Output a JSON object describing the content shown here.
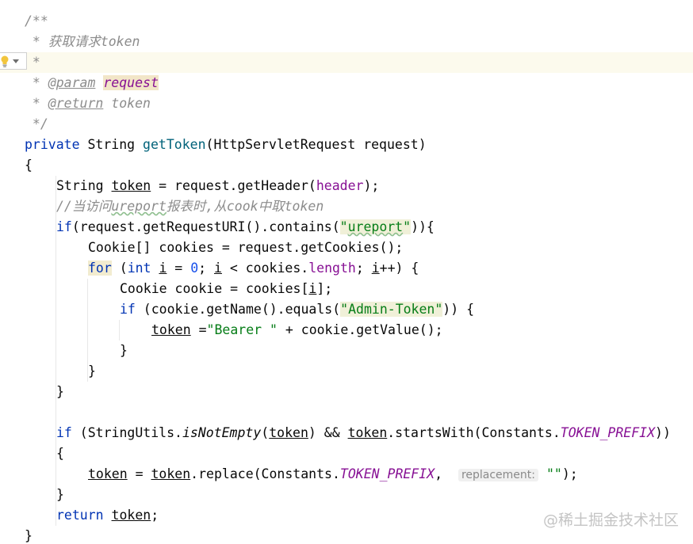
{
  "watermark": "@稀土掘金技术社区",
  "code": {
    "l1_open": "/**",
    "l2_text": " * 获取请求token",
    "l3_star": " *",
    "l4_star": " * ",
    "l4_tag": "@param",
    "l4_name": "request",
    "l5_star": " * ",
    "l5_tag": "@return",
    "l5_text": " token",
    "l6_close": " */",
    "l7_kw": "private",
    "l7_type": " String ",
    "l7_fn": "getToken",
    "l7_sig": "(HttpServletRequest request)",
    "l8_brace": "{",
    "l9_type": "String ",
    "l9_var": "token",
    "l9_mid": " = request.getHeader(",
    "l9_field": "header",
    "l9_end": ");",
    "l10_comment_a": "//当访问",
    "l10_comment_b": "ureport",
    "l10_comment_c": "报表时,从cook中取token",
    "l11_kw": "if",
    "l11_a": "(request.getRequestURI().contains(",
    "l11_str_q1": "\"",
    "l11_str_word": "ureport",
    "l11_str_q2": "\"",
    "l11_end": ")){",
    "l12_text": "Cookie[] cookies = request.getCookies();",
    "l13_kw": "for",
    "l13_a": " (",
    "l13_int": "int",
    "l13_sp": " ",
    "l13_i1": "i",
    "l13_b": " = ",
    "l13_zero": "0",
    "l13_c": "; ",
    "l13_i2": "i",
    "l13_d": " < cookies.",
    "l13_len": "length",
    "l13_e": "; ",
    "l13_i3": "i",
    "l13_f": "++) {",
    "l14_a": "Cookie cookie = cookies[",
    "l14_i": "i",
    "l14_b": "];",
    "l15_kw": "if",
    "l15_a": " (cookie.getName().equals(",
    "l15_str": "\"Admin-Token\"",
    "l15_b": ")) {",
    "l16_var": "token",
    "l16_a": " =",
    "l16_str": "\"Bearer \"",
    "l16_b": " + cookie.getValue();",
    "l17_brace": "}",
    "l18_brace": "}",
    "l19_brace": "}",
    "l21_kw": "if",
    "l21_a": " (StringUtils.",
    "l21_fn": "isNotEmpty",
    "l21_b": "(",
    "l21_var1": "token",
    "l21_c": ") && ",
    "l21_var2": "token",
    "l21_d": ".startsWith(Constants.",
    "l21_const": "TOKEN_PREFIX",
    "l21_e": "))",
    "l22_brace": "{",
    "l23_var1": "token",
    "l23_a": " = ",
    "l23_var2": "token",
    "l23_b": ".replace(Constants.",
    "l23_const": "TOKEN_PREFIX",
    "l23_c": ",  ",
    "l23_hint": "replacement:",
    "l23_sp": " ",
    "l23_str": "\"\"",
    "l23_end": ");",
    "l24_brace": "}",
    "l25_kw": "return",
    "l25_sp": " ",
    "l25_var": "token",
    "l25_end": ";",
    "l26_brace": "}"
  }
}
